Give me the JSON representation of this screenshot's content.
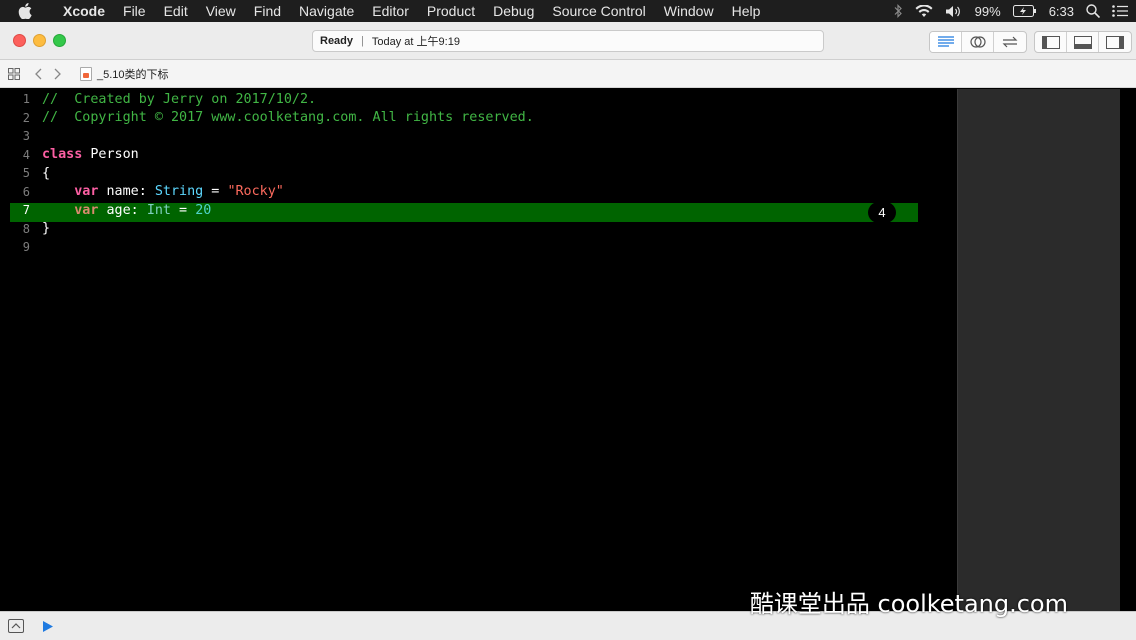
{
  "menubar": {
    "app_name": "Xcode",
    "items": [
      "File",
      "Edit",
      "View",
      "Find",
      "Navigate",
      "Editor",
      "Product",
      "Debug",
      "Source Control",
      "Window",
      "Help"
    ],
    "battery": "99%",
    "clock": "6:33",
    "icons": [
      "apple-icon",
      "bluetooth-icon",
      "wifi-icon",
      "volume-icon",
      "battery-icon",
      "search-icon",
      "list-icon"
    ]
  },
  "toolbar": {
    "status": "Ready",
    "status_detail": "Today at 上午9:19",
    "separator": "|"
  },
  "jumpbar": {
    "file_name": "_5.10类的下标"
  },
  "editor": {
    "highlight_badge": "4",
    "lines": [
      {
        "num": "1",
        "tokens": [
          {
            "t": "//  Created by Jerry on 2017/10/2.",
            "k": "comment"
          }
        ]
      },
      {
        "num": "2",
        "tokens": [
          {
            "t": "//  Copyright © 2017 www.coolketang.com. All rights reserved.",
            "k": "comment"
          }
        ]
      },
      {
        "num": "3",
        "tokens": []
      },
      {
        "num": "4",
        "tokens": [
          {
            "t": "class",
            "k": "keyword"
          },
          {
            "t": " Person",
            "k": "plain"
          }
        ]
      },
      {
        "num": "5",
        "tokens": [
          {
            "t": "{",
            "k": "plain"
          }
        ]
      },
      {
        "num": "6",
        "tokens": [
          {
            "t": "    ",
            "k": "plain"
          },
          {
            "t": "var",
            "k": "keyword"
          },
          {
            "t": " name: ",
            "k": "plain"
          },
          {
            "t": "String",
            "k": "type"
          },
          {
            "t": " = ",
            "k": "plain"
          },
          {
            "t": "\"Rocky\"",
            "k": "string"
          }
        ]
      },
      {
        "num": "7",
        "tokens": [
          {
            "t": "    ",
            "k": "plain"
          },
          {
            "t": "var",
            "k": "keyword"
          },
          {
            "t": " age: ",
            "k": "plain"
          },
          {
            "t": "Int",
            "k": "type"
          },
          {
            "t": " = ",
            "k": "plain"
          },
          {
            "t": "20",
            "k": "number"
          }
        ]
      },
      {
        "num": "8",
        "tokens": [
          {
            "t": "}",
            "k": "plain"
          }
        ]
      },
      {
        "num": "9",
        "tokens": []
      }
    ]
  },
  "watermark": "酷课堂出品 coolketang.com"
}
